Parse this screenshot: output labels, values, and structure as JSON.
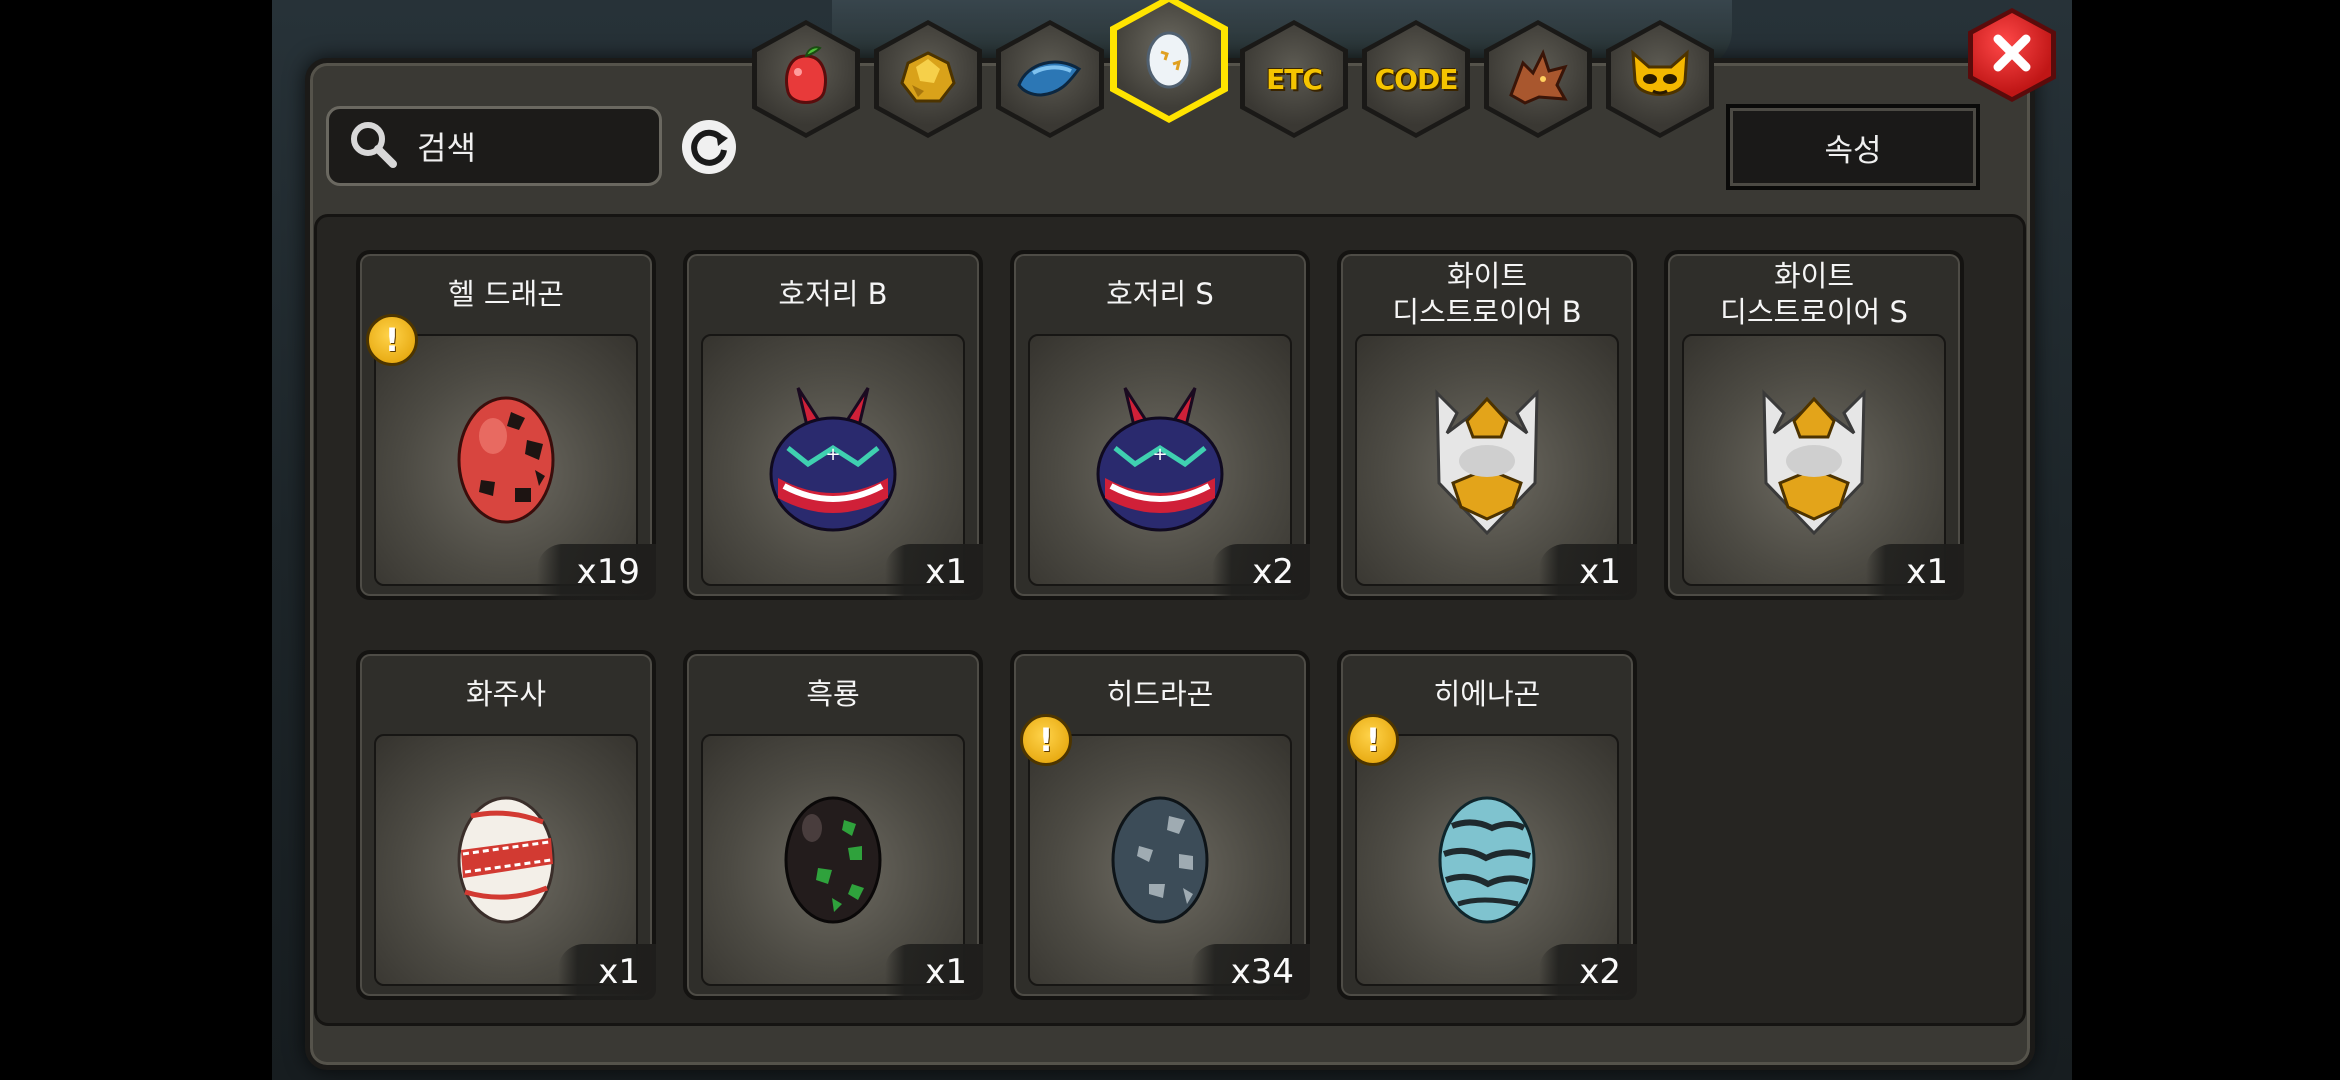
{
  "window": {
    "tabs": [
      {
        "name": "fruit",
        "icon": "fruit-icon"
      },
      {
        "name": "gold",
        "icon": "gold-ore-icon"
      },
      {
        "name": "fish",
        "icon": "fish-icon"
      },
      {
        "name": "egg",
        "icon": "egg-icon",
        "active": true
      },
      {
        "name": "etc",
        "label": "ETC"
      },
      {
        "name": "code",
        "label": "CODE"
      },
      {
        "name": "dragon",
        "icon": "dragon-head-icon"
      },
      {
        "name": "mask",
        "icon": "mask-icon"
      }
    ],
    "search_label": "검색",
    "attribute_button": "속성",
    "accent_color": "#ffe400",
    "close_color": "#e02020"
  },
  "items": [
    {
      "name": "헬 드래곤",
      "count": "x19",
      "alert": "!"
    },
    {
      "name": "호저리 B",
      "count": "x1"
    },
    {
      "name": "호저리 S",
      "count": "x2"
    },
    {
      "name": "화이트\n디스트로이어 B",
      "count": "x1"
    },
    {
      "name": "화이트\n디스트로이어 S",
      "count": "x1"
    },
    {
      "name": "화주사",
      "count": "x1"
    },
    {
      "name": "흑룡",
      "count": "x1"
    },
    {
      "name": "히드라곤",
      "count": "x34",
      "alert": "!"
    },
    {
      "name": "히에나곤",
      "count": "x2",
      "alert": "!"
    }
  ]
}
